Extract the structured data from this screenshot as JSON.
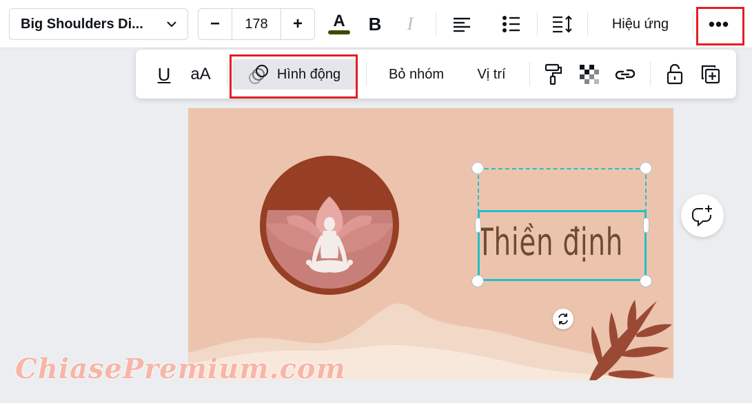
{
  "toolbar": {
    "font_name": "Big Shoulders Di...",
    "font_size": "178",
    "decrease_symbol": "−",
    "increase_symbol": "+",
    "text_color": "#3d4a00",
    "bold_label": "B",
    "italic_label": "I",
    "effects_label": "Hiệu ứng",
    "more_label": "•••"
  },
  "subtoolbar": {
    "underline_label": "U",
    "case_label": "aA",
    "animate_label": "Hình động",
    "ungroup_label": "Bỏ nhóm",
    "position_label": "Vị trí",
    "icons": [
      "paint-roller-icon",
      "transparency-icon",
      "link-icon",
      "lock-icon",
      "duplicate-icon"
    ]
  },
  "canvas": {
    "background": "#ecc4ae",
    "title_text": "Thiền định"
  },
  "watermark": "ChiasePremium.com",
  "colors": {
    "highlight_red": "#e31e24",
    "selection_cyan": "#20c0c9"
  }
}
